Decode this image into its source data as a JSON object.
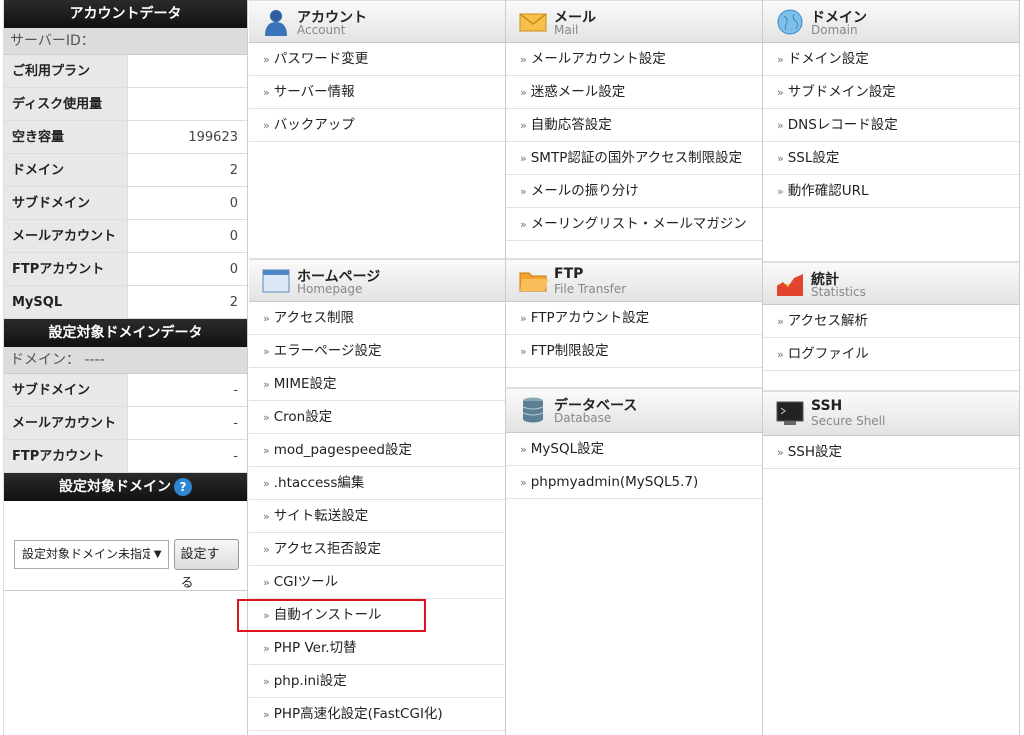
{
  "sidebar": {
    "account_header": "アカウントデータ",
    "server_id_label": "サーバーID：",
    "account_rows": [
      {
        "label": "ご利用プラン",
        "value": ""
      },
      {
        "label": "ディスク使用量",
        "value": ""
      },
      {
        "label": "空き容量",
        "value": "199623"
      },
      {
        "label": "ドメイン",
        "value": "2"
      },
      {
        "label": "サブドメイン",
        "value": "0"
      },
      {
        "label": "メールアカウント",
        "value": "0"
      },
      {
        "label": "FTPアカウント",
        "value": "0"
      },
      {
        "label": "MySQL",
        "value": "2"
      }
    ],
    "target_domain_header": "設定対象ドメインデータ",
    "domain_label": "ドメイン： ----",
    "target_rows": [
      {
        "label": "サブドメイン",
        "value": "-"
      },
      {
        "label": "メールアカウント",
        "value": "-"
      },
      {
        "label": "FTPアカウント",
        "value": "-"
      }
    ],
    "select_header": "設定対象ドメイン",
    "help_glyph": "?",
    "select_value": "設定対象ドメイン未指定",
    "set_button": "設定する"
  },
  "sections": {
    "account": {
      "jp": "アカウント",
      "en": "Account",
      "icon": "user-icon",
      "items": [
        "パスワード変更",
        "サーバー情報",
        "バックアップ"
      ]
    },
    "mail": {
      "jp": "メール",
      "en": "Mail",
      "icon": "envelope-icon",
      "items": [
        "メールアカウント設定",
        "迷惑メール設定",
        "自動応答設定",
        "SMTP認証の国外アクセス制限設定",
        "メールの振り分け",
        "メーリングリスト・メールマガジン"
      ]
    },
    "domain": {
      "jp": "ドメイン",
      "en": "Domain",
      "icon": "globe-icon",
      "items": [
        "ドメイン設定",
        "サブドメイン設定",
        "DNSレコード設定",
        "SSL設定",
        "動作確認URL"
      ]
    },
    "homepage": {
      "jp": "ホームページ",
      "en": "Homepage",
      "icon": "window-icon",
      "items": [
        "アクセス制限",
        "エラーページ設定",
        "MIME設定",
        "Cron設定",
        "mod_pagespeed設定",
        ".htaccess編集",
        "サイト転送設定",
        "アクセス拒否設定",
        "CGIツール",
        "自動インストール",
        "PHP Ver.切替",
        "php.ini設定",
        "PHP高速化設定(FastCGI化)"
      ]
    },
    "ftp": {
      "jp": "FTP",
      "en": "File Transfer",
      "icon": "folder-icon",
      "items": [
        "FTPアカウント設定",
        "FTP制限設定"
      ]
    },
    "database": {
      "jp": "データベース",
      "en": "Database",
      "icon": "database-icon",
      "items": [
        "MySQL設定",
        "phpmyadmin(MySQL5.7)"
      ]
    },
    "stats": {
      "jp": "統計",
      "en": "Statistics",
      "icon": "bar-chart-icon",
      "items": [
        "アクセス解析",
        "ログファイル"
      ]
    },
    "ssh": {
      "jp": "SSH",
      "en": "Secure Shell",
      "icon": "terminal-icon",
      "items": [
        "SSH設定"
      ]
    }
  },
  "item_arrow": "»",
  "highlight_color": "#e0141e"
}
